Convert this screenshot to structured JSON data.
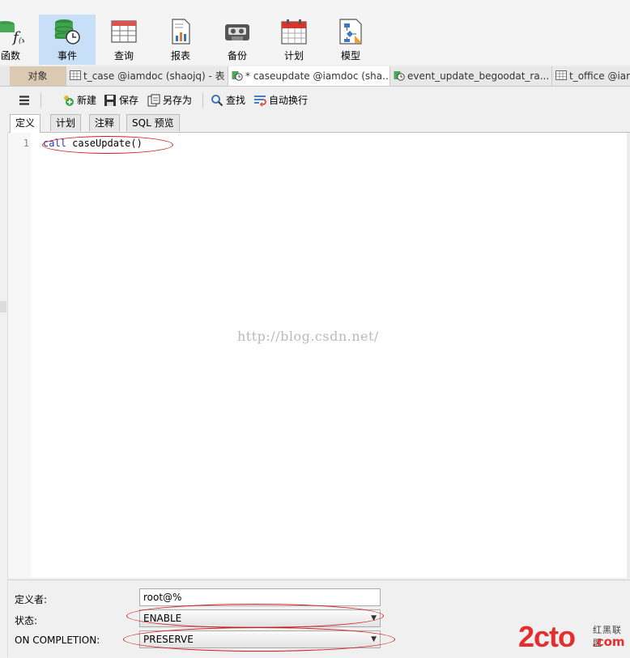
{
  "toolbar": {
    "items": [
      {
        "label": "函数",
        "icon": "function-icon"
      },
      {
        "label": "事件",
        "icon": "event-icon",
        "active": true
      },
      {
        "label": "查询",
        "icon": "query-icon"
      },
      {
        "label": "报表",
        "icon": "report-icon"
      },
      {
        "label": "备份",
        "icon": "backup-icon"
      },
      {
        "label": "计划",
        "icon": "schedule-icon"
      },
      {
        "label": "模型",
        "icon": "model-icon"
      }
    ]
  },
  "object_tabs": [
    {
      "label": "对象"
    },
    {
      "label": "t_case @iamdoc (shaojq) - 表",
      "icon": "table-icon"
    },
    {
      "label": "* caseupdate @iamdoc (sha...",
      "icon": "event-icon",
      "current": true
    },
    {
      "label": "event_update_begoodat_ra...",
      "icon": "event-icon"
    },
    {
      "label": "t_office @iam",
      "icon": "table-icon"
    }
  ],
  "editor_toolbar": {
    "menu_icon": "hamburger-icon",
    "new": "新建",
    "save": "保存",
    "save_as": "另存为",
    "find": "查找",
    "word_wrap": "自动换行"
  },
  "sub_tabs": [
    {
      "label": "定义",
      "active": true
    },
    {
      "label": "计划"
    },
    {
      "label": "注释"
    },
    {
      "label": "SQL 预览"
    }
  ],
  "editor": {
    "line_number": "1",
    "keyword": "call",
    "code_rest": " caseUpdate()",
    "watermark": "http://blog.csdn.net/"
  },
  "properties": {
    "definer_label": "定义者:",
    "definer_value": "root@%",
    "status_label": "状态:",
    "status_value": "ENABLE",
    "completion_label": "ON COMPLETION:",
    "completion_value": "PRESERVE"
  },
  "logo": {
    "main": "2cto",
    "sub": "红黑联盟",
    "domain": ".com"
  },
  "colors": {
    "accent_active": "#c7e0f7",
    "objects_tab": "#dcc9b2",
    "annotation": "#d51a1a",
    "keyword": "#1b3cc1"
  }
}
